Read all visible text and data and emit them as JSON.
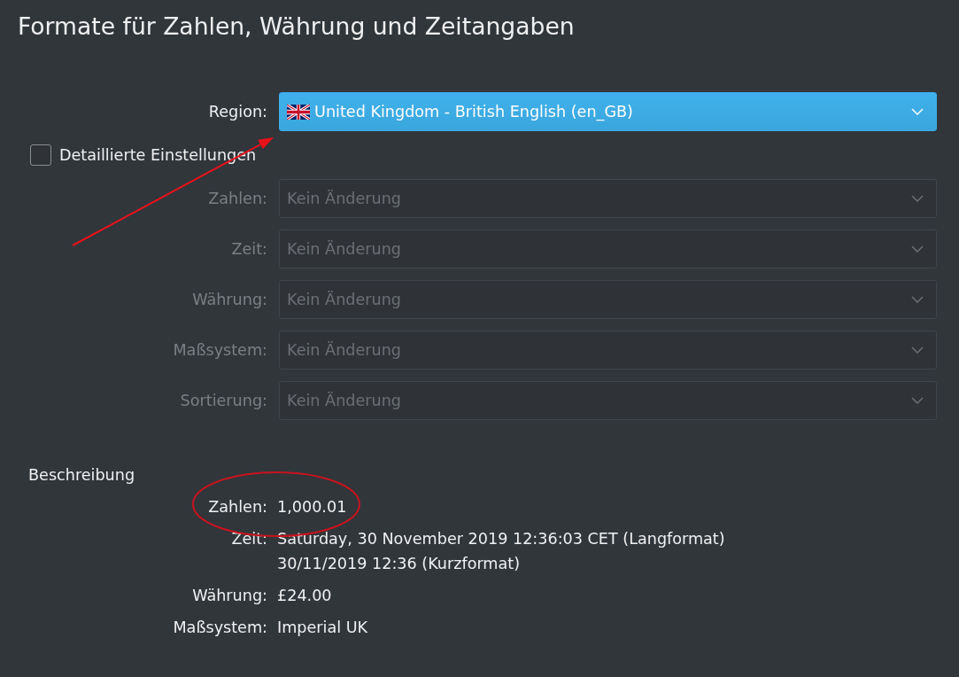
{
  "title": "Formate für Zahlen, Währung und Zeitangaben",
  "region": {
    "label": "Region:",
    "value": "United Kingdom - British English (en_GB)",
    "focused": true
  },
  "detailed_settings": {
    "label": "Detaillierte Einstellungen",
    "checked": false
  },
  "detail_fields": [
    {
      "label": "Zahlen:",
      "value": "Kein Änderung",
      "disabled": true
    },
    {
      "label": "Zeit:",
      "value": "Kein Änderung",
      "disabled": true
    },
    {
      "label": "Währung:",
      "value": "Kein Änderung",
      "disabled": true
    },
    {
      "label": "Maßsystem:",
      "value": "Kein Änderung",
      "disabled": true
    },
    {
      "label": "Sortierung:",
      "value": "Kein Änderung",
      "disabled": true
    }
  ],
  "description": {
    "heading": "Beschreibung",
    "rows": [
      {
        "label": "Zahlen:",
        "lines": [
          "1,000.01"
        ]
      },
      {
        "label": "Zeit:",
        "lines": [
          "Saturday, 30 November 2019 12:36:03 CET (Langformat)",
          "30/11/2019 12:36 (Kurzformat)"
        ]
      },
      {
        "label": "Währung:",
        "lines": [
          "£24.00"
        ]
      },
      {
        "label": "Maßsystem:",
        "lines": [
          "Imperial UK"
        ]
      }
    ]
  },
  "annotations": [
    {
      "kind": "arrow"
    },
    {
      "kind": "ellipse"
    }
  ]
}
